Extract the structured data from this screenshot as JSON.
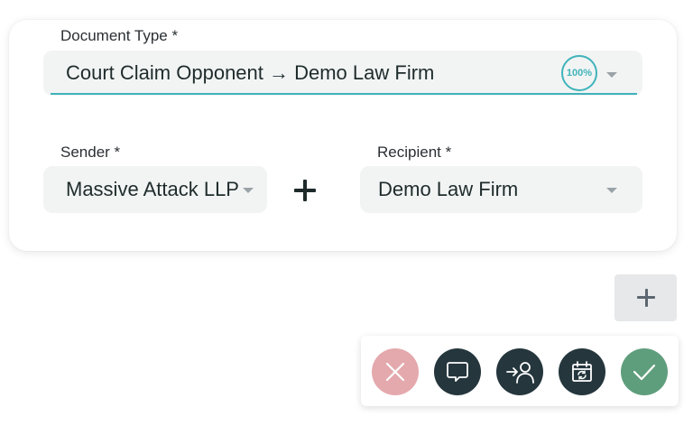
{
  "document_type": {
    "label": "Document Type *",
    "value": "Court Claim  Opponent → Demo Law Firm",
    "confidence": "100%"
  },
  "sender": {
    "label": "Sender *",
    "value": "Massive Attack LLP"
  },
  "recipient": {
    "label": "Recipient *",
    "value": "Demo Law Firm"
  },
  "toolbar": {
    "reject_icon": "close-icon",
    "comment_icon": "speech-bubble-icon",
    "assign_icon": "assign-user-icon",
    "reschedule_icon": "calendar-refresh-icon",
    "approve_icon": "check-icon"
  },
  "colors": {
    "accent": "#3fb3ba",
    "reject": "#e4a9ad",
    "dark_button": "#25363d",
    "approve": "#5f9e7c"
  }
}
